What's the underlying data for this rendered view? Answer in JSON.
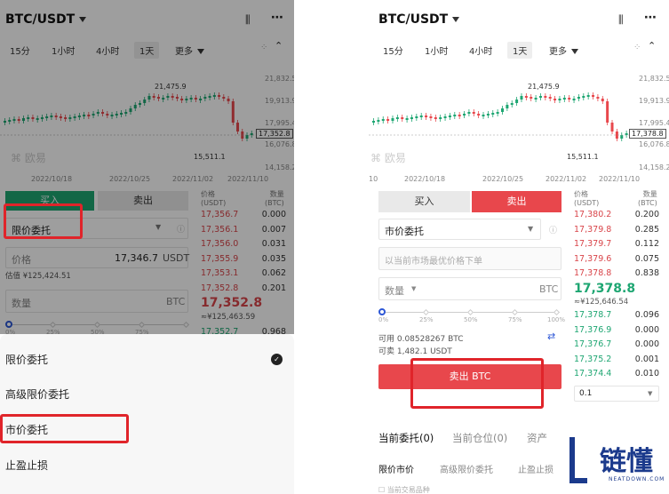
{
  "symbol": "BTC/USDT",
  "timeframes": [
    "15分",
    "1小时",
    "4小时",
    "1天",
    "更多"
  ],
  "selected_timeframe": "1天",
  "chart": {
    "price_axis": [
      "21,832.5",
      "19,913.9",
      "17,995.4",
      "16,076.8",
      "14,158.2"
    ],
    "high_label": "21,475.9",
    "low_label": "15,511.1",
    "last_price_tag": "17,352.8",
    "last_price_tag_right": "17,378.8",
    "dates": [
      "2022/10/18",
      "2022/10/25",
      "2022/11/02",
      "2022/11/10"
    ],
    "dates_right": [
      "10",
      "2022/10/18",
      "2022/10/25",
      "2022/11/02",
      "2022/11/10"
    ],
    "watermark": "欧易"
  },
  "orderbook_header": {
    "price": "价格",
    "price_unit": "(USDT)",
    "qty": "数量",
    "qty_unit": "(BTC)"
  },
  "left": {
    "buy_label": "买入",
    "sell_label": "卖出",
    "order_type": "限价委托",
    "price_label": "价格",
    "price_value": "17,346.7",
    "price_unit": "USDT",
    "estimate": "估值 ¥125,424.51",
    "qty_label": "数量",
    "qty_unit": "BTC",
    "pct": [
      "0%",
      "25%",
      "50%",
      "75%",
      "100%"
    ],
    "asks": [
      [
        "17,356.7",
        "0.000"
      ],
      [
        "17,356.1",
        "0.007"
      ],
      [
        "17,356.0",
        "0.031"
      ],
      [
        "17,355.9",
        "0.035"
      ],
      [
        "17,353.1",
        "0.062"
      ],
      [
        "17,352.8",
        "0.201"
      ]
    ],
    "mid_price": "17,352.8",
    "mid_cny": "≈¥125,463.59",
    "bids": [
      [
        "17,352.7",
        "0.968"
      ]
    ],
    "sheet_items": [
      "限价委托",
      "高级限价委托",
      "市价委托",
      "止盈止损"
    ]
  },
  "right": {
    "buy_label": "买入",
    "sell_label": "卖出",
    "order_type": "市价委托",
    "market_placeholder": "以当前市场最优价格下单",
    "qty_label": "数量",
    "qty_unit": "BTC",
    "pct": [
      "0%",
      "25%",
      "50%",
      "75%",
      "100%"
    ],
    "available": "可用 0.08528267 BTC",
    "sellable": "可卖 1,482.1 USDT",
    "sell_button": "卖出 BTC",
    "asks": [
      [
        "17,380.2",
        "0.200"
      ],
      [
        "17,379.8",
        "0.285"
      ],
      [
        "17,379.7",
        "0.112"
      ],
      [
        "17,379.6",
        "0.075"
      ],
      [
        "17,378.8",
        "0.838"
      ]
    ],
    "mid_price": "17,378.8",
    "mid_cny": "≈¥125,646.54",
    "bids": [
      [
        "17,378.7",
        "0.096"
      ],
      [
        "17,376.9",
        "0.000"
      ],
      [
        "17,376.7",
        "0.000"
      ],
      [
        "17,375.2",
        "0.001"
      ],
      [
        "17,374.4",
        "0.010"
      ]
    ],
    "depth_select": "0.1",
    "bottom_tabs": [
      "当前委托(0)",
      "当前仓位(0)",
      "资产"
    ],
    "order_tabs": [
      "限价市价",
      "高级限价委托",
      "止盈止损"
    ],
    "footer_partial": "当前交易品种"
  },
  "logo": {
    "name": "链懂",
    "url": "NEATDOWN.COM"
  },
  "colors": {
    "red": "#e8474c",
    "green": "#1ea672",
    "highlight": "#e0242a"
  }
}
